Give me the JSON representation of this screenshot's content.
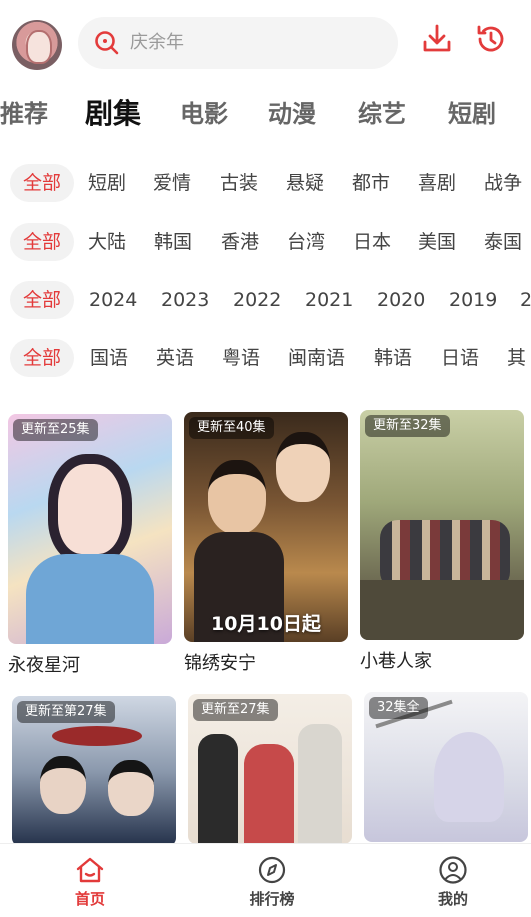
{
  "colors": {
    "accent": "#e8353b",
    "chip_bg": "#f2f2f2",
    "text": "#333333"
  },
  "search": {
    "placeholder": "庆余年"
  },
  "tabs": [
    {
      "label": "推荐"
    },
    {
      "label": "剧集",
      "active": true
    },
    {
      "label": "电影"
    },
    {
      "label": "动漫"
    },
    {
      "label": "综艺"
    },
    {
      "label": "短剧"
    }
  ],
  "filters": {
    "genre": [
      "全部",
      "短剧",
      "爱情",
      "古装",
      "悬疑",
      "都市",
      "喜剧",
      "战争"
    ],
    "region": [
      "全部",
      "大陆",
      "韩国",
      "香港",
      "台湾",
      "日本",
      "美国",
      "泰国"
    ],
    "year": [
      "全部",
      "2024",
      "2023",
      "2022",
      "2021",
      "2020",
      "2019",
      "2"
    ],
    "language": [
      "全部",
      "国语",
      "英语",
      "粤语",
      "闽南语",
      "韩语",
      "日语",
      "其"
    ]
  },
  "cards": [
    {
      "title": "永夜星河",
      "badge": "更新至25集"
    },
    {
      "title": "锦绣安宁",
      "badge": "更新至40集",
      "caption": "10月10日起"
    },
    {
      "title": "小巷人家",
      "badge": "更新至32集"
    },
    {
      "title": "",
      "badge": "更新至第27集"
    },
    {
      "title": "",
      "badge": "更新至27集"
    },
    {
      "title": "",
      "badge": "32集全"
    }
  ],
  "nav": [
    {
      "label": "首页",
      "icon": "home-icon",
      "active": true
    },
    {
      "label": "排行榜",
      "icon": "compass-icon"
    },
    {
      "label": "我的",
      "icon": "user-icon"
    }
  ]
}
